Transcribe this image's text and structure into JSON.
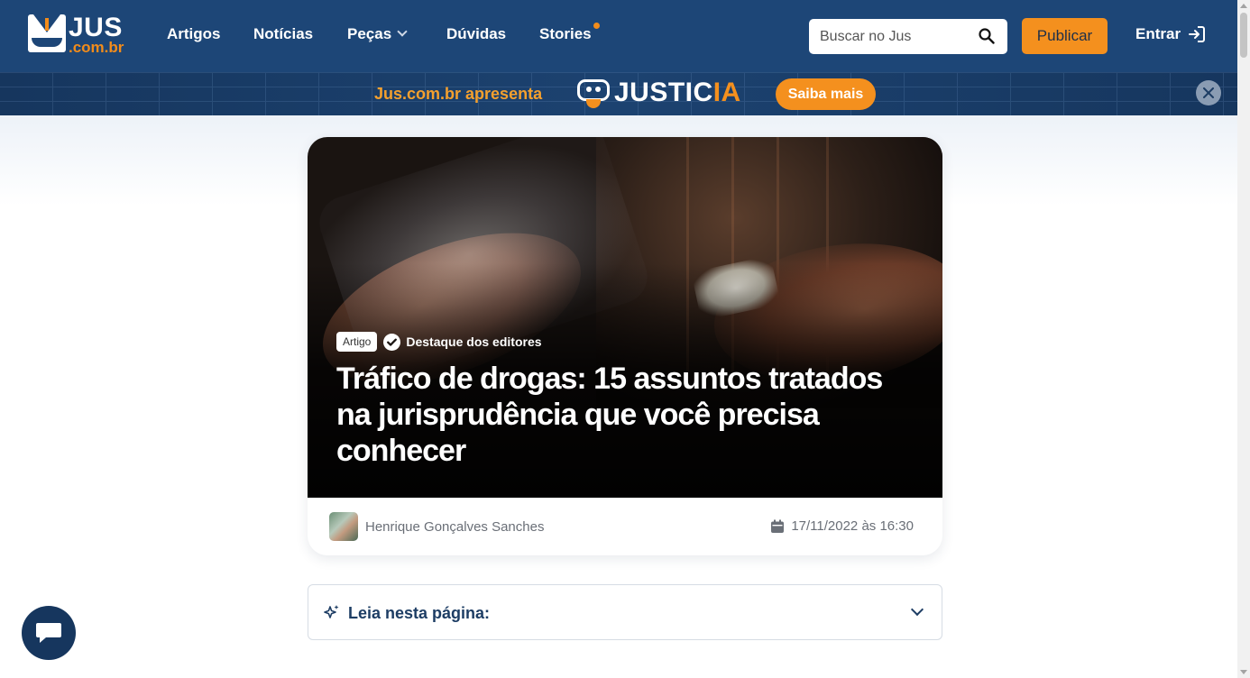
{
  "brand": {
    "name": "JUS",
    "domain": ".com.br"
  },
  "nav": {
    "items": [
      {
        "label": "Artigos"
      },
      {
        "label": "Notícias"
      },
      {
        "label": "Peças"
      },
      {
        "label": "Dúvidas"
      },
      {
        "label": "Stories"
      }
    ]
  },
  "search": {
    "placeholder": "Buscar no Jus",
    "value": ""
  },
  "header": {
    "publish_label": "Publicar",
    "login_label": "Entrar"
  },
  "promo": {
    "text": "Jus.com.br apresenta",
    "product_white": "JUSTIC",
    "product_orange": "IA",
    "cta_label": "Saiba mais"
  },
  "article": {
    "tag": "Artigo",
    "featured": "Destaque dos editores",
    "title": "Tráfico de drogas: 15 assuntos tratados na jurisprudência que você precisa conhecer",
    "author": "Henrique Gonçalves Sanches",
    "date": "17/11/2022 às 16:30"
  },
  "toc": {
    "label": "Leia nesta página:"
  },
  "colors": {
    "navy": "#1d4677",
    "orange": "#f4901e",
    "toc_text": "#1d3d64"
  },
  "icons": [
    "search-icon",
    "login-icon",
    "close-icon",
    "check-icon",
    "calendar-icon",
    "sparkle-icon",
    "chevron-down-icon",
    "chat-icon"
  ]
}
